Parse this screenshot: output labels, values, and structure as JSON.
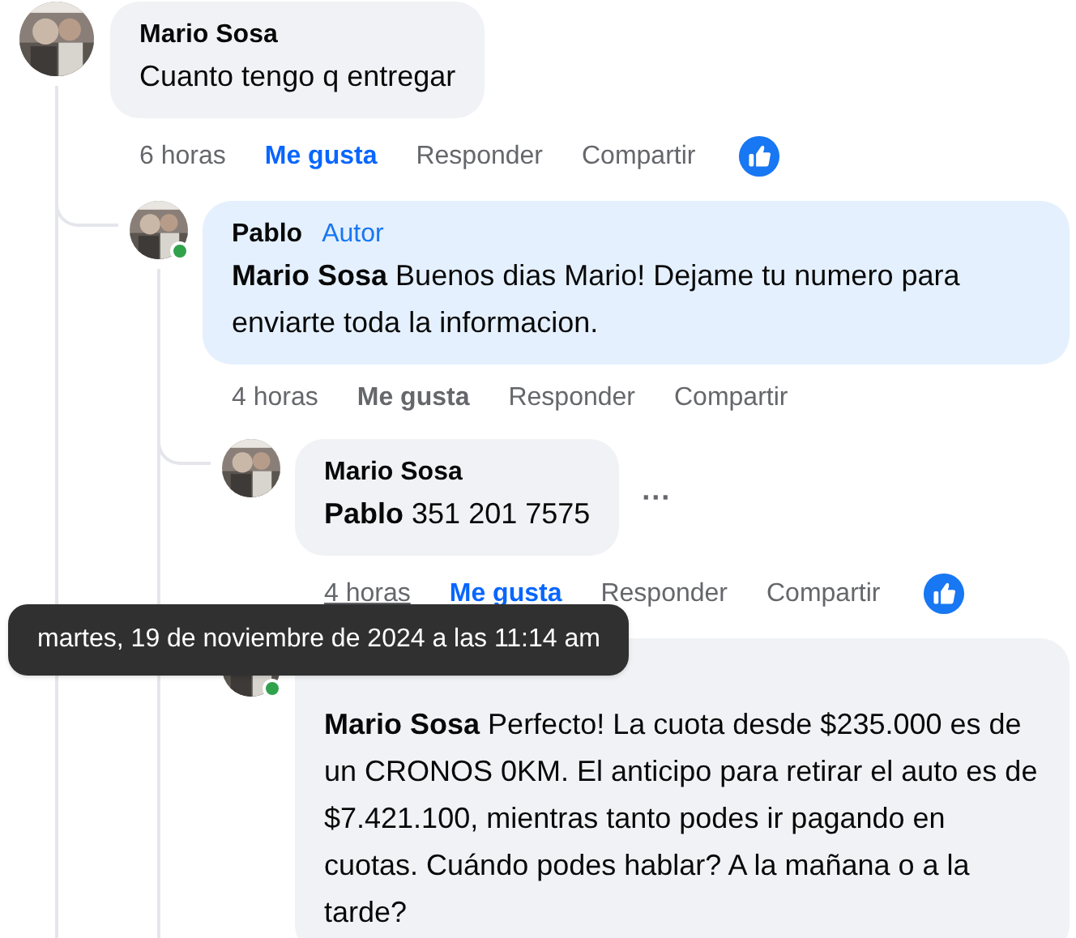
{
  "comments": [
    {
      "author": "Mario Sosa",
      "text": "Cuanto tengo q entregar",
      "time": "6 horas",
      "time_hovered": false,
      "like_label": "Me gusta",
      "liked": true,
      "reply_label": "Responder",
      "share_label": "Compartir",
      "highlighted": false,
      "reaction": true,
      "children": [
        {
          "author": "Pablo",
          "badge": "Autor",
          "mention": "Mario Sosa",
          "text": "Buenos dias Mario! Dejame tu numero para enviarte toda la informacion.",
          "time": "4 horas",
          "time_hovered": false,
          "like_label": "Me gusta",
          "liked": false,
          "reply_label": "Responder",
          "share_label": "Compartir",
          "online": true,
          "highlighted": true,
          "children": [
            {
              "author": "Mario Sosa",
              "mention": "Pablo",
              "text": "351 201 7575",
              "more_label": "···",
              "time": "4 horas",
              "time_hovered": true,
              "like_label": "Me gusta",
              "liked": true,
              "reply_label": "Responder",
              "share_label": "Compartir",
              "highlighted": false,
              "reaction": true
            },
            {
              "mention": "Mario Sosa",
              "text": "Perfecto! La cuota desde $235.000 es de un CRONOS 0KM. El anticipo para retirar el auto es de $7.421.100, mientras tanto podes ir pagando en cuotas. Cuándo podes hablar? A la mañana o a la tarde?",
              "online": true,
              "highlighted": false
            }
          ]
        }
      ]
    }
  ],
  "tooltip": {
    "text": "martes, 19 de noviembre de 2024 a las 11:14 am"
  }
}
